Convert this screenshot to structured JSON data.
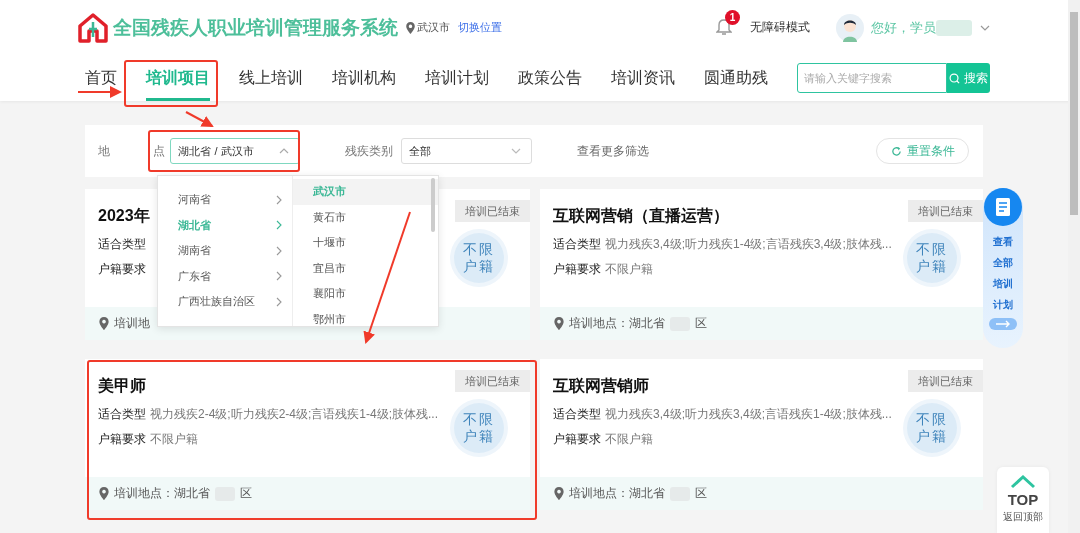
{
  "header": {
    "site_title": "全国残疾人职业培训管理服务系统",
    "location": "武汉市",
    "switch_location": "切换位置",
    "notification_count": "1",
    "accessibility_mode": "无障碍模式",
    "greeting": "您好，学员"
  },
  "nav": {
    "tabs": [
      {
        "label": "首页",
        "selected": false
      },
      {
        "label": "培训项目",
        "selected": true
      },
      {
        "label": "线上培训",
        "selected": false
      },
      {
        "label": "培训机构",
        "selected": false
      },
      {
        "label": "培训计划",
        "selected": false
      },
      {
        "label": "政策公告",
        "selected": false
      },
      {
        "label": "培训资讯",
        "selected": false
      },
      {
        "label": "圆通助残",
        "selected": false
      }
    ],
    "search": {
      "placeholder": "请输入关键字搜索",
      "button": "搜索"
    }
  },
  "filters": {
    "location_label": "地 点",
    "location_value": "湖北省 / 武汉市",
    "location_expanded": true,
    "category_label": "残疾类别",
    "category_value": "全部",
    "more_filters": "查看更多筛选",
    "reset": "重置条件"
  },
  "location_dropdown": {
    "provinces": [
      {
        "label": "河南省",
        "selected": false
      },
      {
        "label": "湖北省",
        "selected": true
      },
      {
        "label": "湖南省",
        "selected": false
      },
      {
        "label": "广东省",
        "selected": false
      },
      {
        "label": "广西壮族自治区",
        "selected": false
      }
    ],
    "cities": [
      {
        "label": "武汉市",
        "selected": true
      },
      {
        "label": "黄石市",
        "selected": false
      },
      {
        "label": "十堰市",
        "selected": false
      },
      {
        "label": "宜昌市",
        "selected": false
      },
      {
        "label": "襄阳市",
        "selected": false
      },
      {
        "label": "鄂州市",
        "selected": false
      }
    ]
  },
  "cards": [
    {
      "title": "2023年",
      "status": "培训已结束",
      "type_label": "适合类型",
      "household_label": "户籍要求",
      "stamp": [
        "不限",
        "户籍"
      ],
      "location": "培训地"
    },
    {
      "title": "互联网营销（直播运营）",
      "status": "培训已结束",
      "type_label": "适合类型",
      "type_value": "视力残疾3,4级;听力残疾1-4级;言语残疾3,4级;肢体残...",
      "household_label": "户籍要求",
      "household_value": "不限户籍",
      "stamp": [
        "不限",
        "户籍"
      ],
      "location": "培训地点：湖北省",
      "location_suffix": "区"
    },
    {
      "title": "美甲师",
      "status": "培训已结束",
      "type_label": "适合类型",
      "type_value": "视力残疾2-4级;听力残疾2-4级;言语残疾1-4级;肢体残...",
      "household_label": "户籍要求",
      "household_value": "不限户籍",
      "stamp": [
        "不限",
        "户籍"
      ],
      "location": "培训地点：湖北省",
      "location_suffix": "区"
    },
    {
      "title": "互联网营销师",
      "status": "培训已结束",
      "type_label": "适合类型",
      "type_value": "视力残疾3,4级;听力残疾3,4级;言语残疾1-4级;肢体残...",
      "household_label": "户籍要求",
      "household_value": "不限户籍",
      "stamp": [
        "不限",
        "户籍"
      ],
      "location": "培训地点：湖北省",
      "location_suffix": "区"
    }
  ],
  "side_panel": {
    "text": "查看全部培训计划"
  },
  "back_to_top": {
    "label": "TOP",
    "caption": "返回顶部"
  }
}
